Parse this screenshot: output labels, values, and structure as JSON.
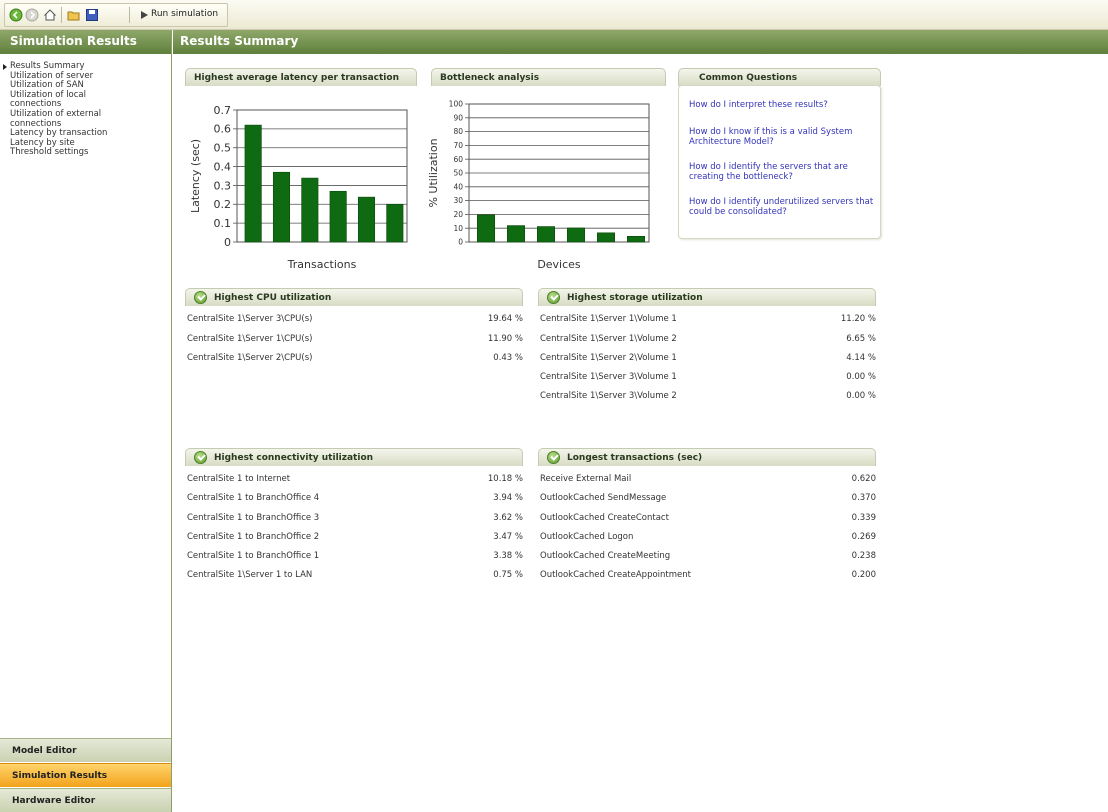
{
  "toolbar": {
    "run_label": "Run simulation"
  },
  "sidebar": {
    "title": "Simulation Results",
    "items": [
      {
        "label": "Results Summary"
      },
      {
        "label": "Utilization of server"
      },
      {
        "label": "Utilization of SAN"
      },
      {
        "label": "Utilization of local connections"
      },
      {
        "label": "Utilization of external connections"
      },
      {
        "label": "Latency by transaction"
      },
      {
        "label": "Latency by site"
      },
      {
        "label": "Threshold settings"
      }
    ],
    "bottom_tabs": [
      {
        "label": "Model Editor"
      },
      {
        "label": "Simulation Results"
      },
      {
        "label": "Hardware Editor"
      }
    ]
  },
  "main": {
    "title": "Results Summary"
  },
  "latency_panel": {
    "title": "Highest average latency per transaction"
  },
  "bottleneck_panel": {
    "title": "Bottleneck analysis"
  },
  "questions": {
    "title": "Common Questions",
    "links": [
      "How do I interpret these results?",
      "How do I know if this is a valid System Architecture Model?",
      "How do I identify the servers that are creating the bottleneck?",
      "How do I identify underutilized servers that could be consolidated?"
    ]
  },
  "cpu": {
    "title": "Highest CPU utilization",
    "rows": [
      {
        "name": "CentralSite 1\\Server 3\\CPU(s)",
        "value": "19.64 %"
      },
      {
        "name": "CentralSite 1\\Server 1\\CPU(s)",
        "value": "11.90 %"
      },
      {
        "name": "CentralSite 1\\Server 2\\CPU(s)",
        "value": "0.43 %"
      }
    ]
  },
  "storage": {
    "title": "Highest storage utilization",
    "rows": [
      {
        "name": "CentralSite 1\\Server 1\\Volume 1",
        "value": "11.20 %"
      },
      {
        "name": "CentralSite 1\\Server 1\\Volume 2",
        "value": "6.65 %"
      },
      {
        "name": "CentralSite 1\\Server 2\\Volume 1",
        "value": "4.14 %"
      },
      {
        "name": "CentralSite 1\\Server 3\\Volume 1",
        "value": "0.00 %"
      },
      {
        "name": "CentralSite 1\\Server 3\\Volume 2",
        "value": "0.00 %"
      }
    ]
  },
  "connectivity": {
    "title": "Highest connectivity utilization",
    "rows": [
      {
        "name": "CentralSite 1 to Internet",
        "value": "10.18 %"
      },
      {
        "name": "CentralSite 1 to BranchOffice 4",
        "value": "3.94 %"
      },
      {
        "name": "CentralSite 1 to BranchOffice 3",
        "value": "3.62 %"
      },
      {
        "name": "CentralSite 1 to BranchOffice 2",
        "value": "3.47 %"
      },
      {
        "name": "CentralSite 1 to BranchOffice 1",
        "value": "3.38 %"
      },
      {
        "name": "CentralSite 1\\Server 1 to LAN",
        "value": "0.75 %"
      }
    ]
  },
  "transactions": {
    "title": "Longest transactions (sec)",
    "rows": [
      {
        "name": "Receive External Mail",
        "value": "0.620"
      },
      {
        "name": "OutlookCached SendMessage",
        "value": "0.370"
      },
      {
        "name": "OutlookCached CreateContact",
        "value": "0.339"
      },
      {
        "name": "OutlookCached Logon",
        "value": "0.269"
      },
      {
        "name": "OutlookCached CreateMeeting",
        "value": "0.238"
      },
      {
        "name": "OutlookCached CreateAppointment",
        "value": "0.200"
      }
    ]
  },
  "colors": {
    "header_green": "#6f8c4a",
    "bar_green": "#0f6b12",
    "active_tab": "#f4a91e",
    "link_blue": "#3333bb"
  },
  "chart_data": [
    {
      "type": "bar",
      "xlabel": "Transactions",
      "ylabel": "Latency (sec)",
      "ylim": [
        0,
        0.7
      ],
      "yticks": [
        "0",
        "0.1",
        "0.2",
        "0.3",
        "0.4",
        "0.5",
        "0.6",
        "0.7"
      ],
      "values": [
        0.62,
        0.37,
        0.339,
        0.269,
        0.238,
        0.2
      ],
      "grid": true
    },
    {
      "type": "bar",
      "xlabel": "Devices",
      "ylabel": "% Utilization",
      "ylim": [
        0,
        100
      ],
      "yticks": [
        "0",
        "10",
        "20",
        "30",
        "40",
        "50",
        "60",
        "70",
        "80",
        "90",
        "100"
      ],
      "values": [
        19.64,
        11.9,
        11.2,
        10.18,
        6.65,
        4.14
      ],
      "grid": true
    }
  ]
}
